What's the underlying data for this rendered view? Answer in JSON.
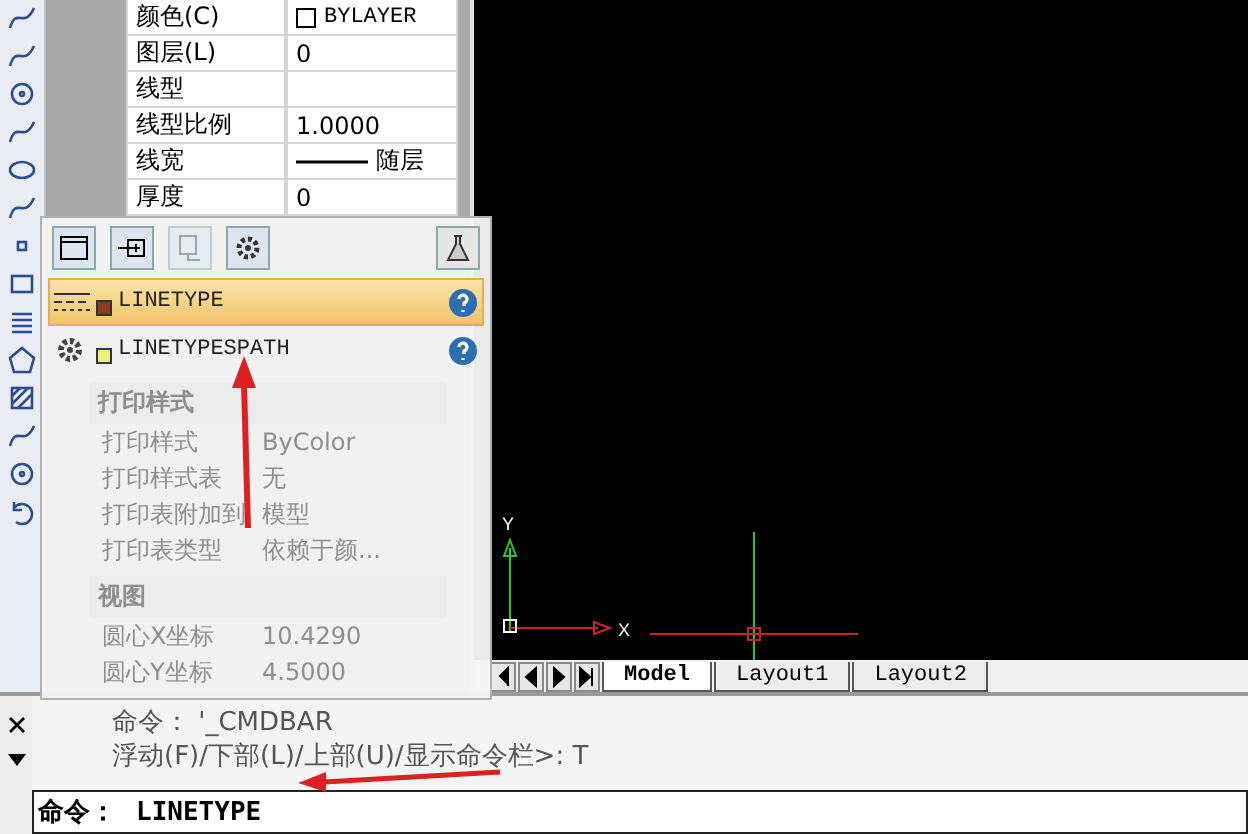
{
  "properties": [
    {
      "label": "颜色(C)",
      "value": "BYLAYER",
      "kind": "color"
    },
    {
      "label": "图层(L)",
      "value": "0",
      "kind": "text"
    },
    {
      "label": "线型",
      "kind": "text"
    },
    {
      "label": "线型比例",
      "value": "1.0000",
      "kind": "text"
    },
    {
      "label": "线宽",
      "value": "随层",
      "kind": "lineweight"
    },
    {
      "label": "厚度",
      "value": "0",
      "kind": "text"
    }
  ],
  "popup": {
    "items": [
      {
        "name": "LINETYPE",
        "kind": "linetype",
        "selected": true,
        "color": "#8b3a2a"
      },
      {
        "name": "LINETYPESPATH",
        "kind": "setting",
        "selected": false,
        "color": "#f2ee7a"
      }
    ],
    "faded_sections": [
      {
        "title": "打印样式",
        "rows": [
          {
            "label": "打印样式",
            "value": "ByColor"
          },
          {
            "label": "打印样式表",
            "value": "无"
          },
          {
            "label": "打印表附加到",
            "value": "模型"
          },
          {
            "label": "打印表类型",
            "value": "依赖于颜..."
          }
        ]
      },
      {
        "title": "视图",
        "rows": [
          {
            "label": "圆心X坐标",
            "value": "10.4290"
          },
          {
            "label": "圆心Y坐标",
            "value": "4.5000"
          }
        ]
      }
    ]
  },
  "canvas": {
    "x_label": "X",
    "y_label": "Y"
  },
  "layout_tabs": [
    {
      "label": "Model",
      "selected": true
    },
    {
      "label": "Layout1",
      "selected": false
    },
    {
      "label": "Layout2",
      "selected": false
    }
  ],
  "command": {
    "history": [
      "命令： '_CMDBAR",
      "浮动(F)/下部(L)/上部(U)/显示命令栏>: T"
    ],
    "prompt": "命令：",
    "input": "LINETYPE"
  }
}
